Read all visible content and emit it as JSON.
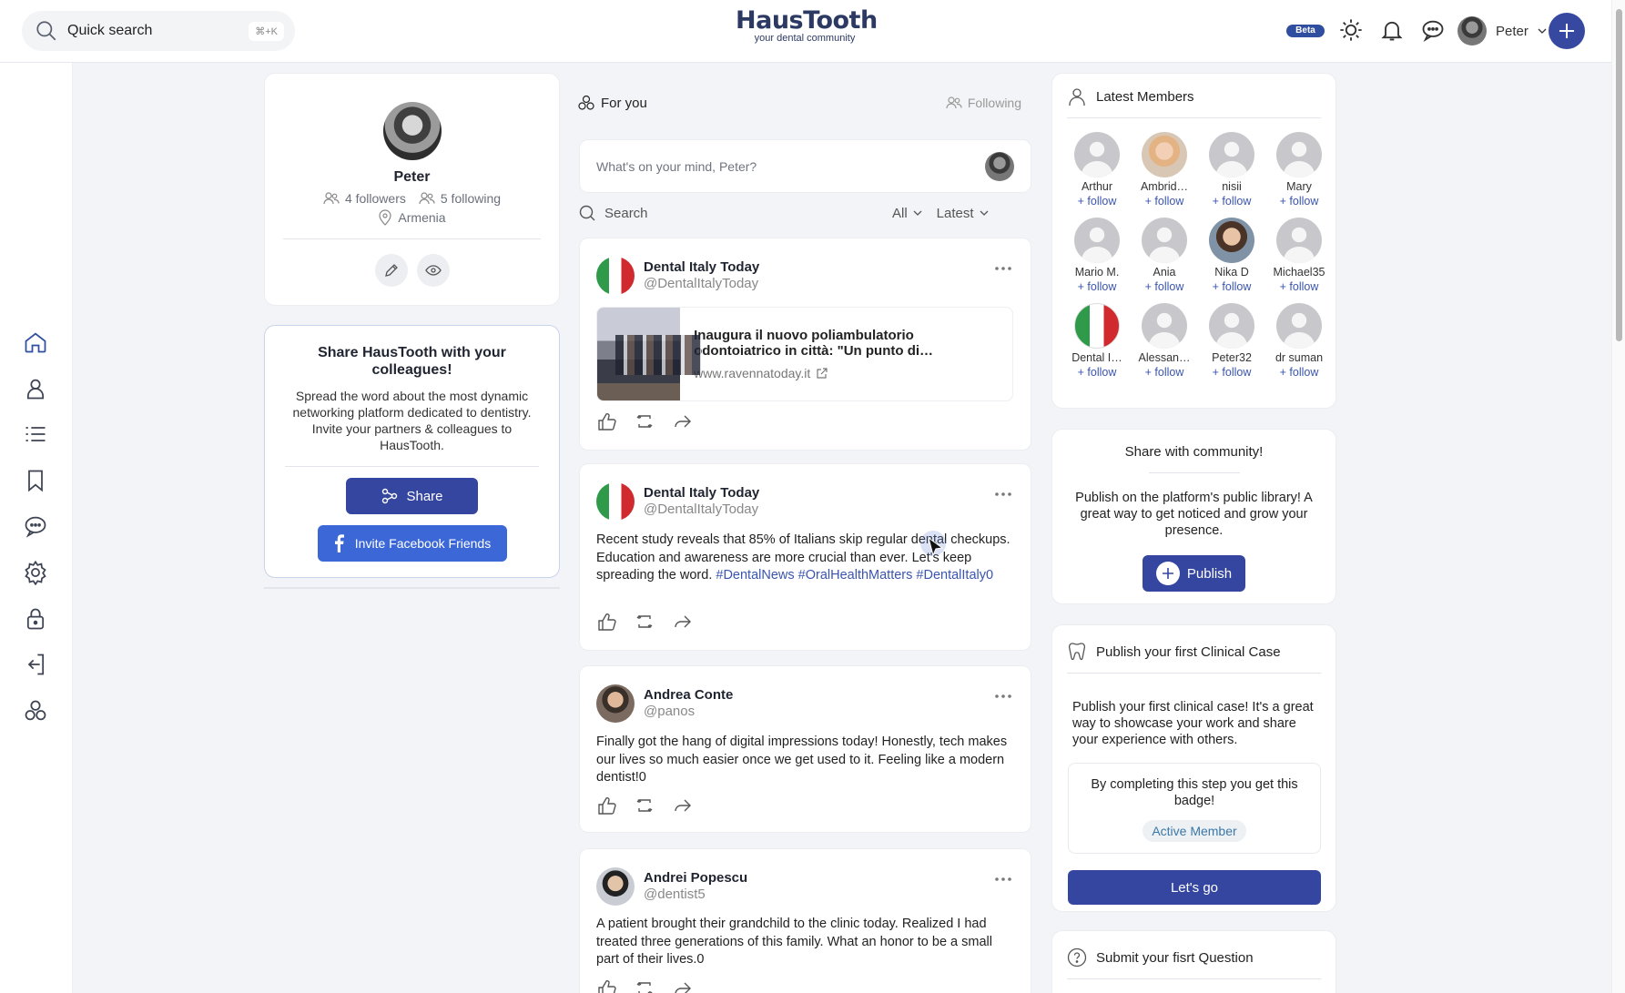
{
  "header": {
    "search_placeholder": "Quick search",
    "search_shortcut": "⌘+K",
    "brand_name": "HausTooth",
    "brand_tagline": "your dental community",
    "beta_label": "Beta",
    "user_name": "Peter"
  },
  "colors": {
    "primary": "#3546a0",
    "facebook": "#3b67d7",
    "link": "#3a55b0",
    "background": "#f3f4f7"
  },
  "sidebar": {
    "items": [
      {
        "name": "home",
        "icon": "home-icon"
      },
      {
        "name": "profile",
        "icon": "user-icon"
      },
      {
        "name": "list",
        "icon": "list-icon"
      },
      {
        "name": "bookmarks",
        "icon": "bookmark-icon"
      },
      {
        "name": "messages",
        "icon": "chat-icon"
      },
      {
        "name": "settings",
        "icon": "gear-icon"
      },
      {
        "name": "privacy",
        "icon": "lock-icon"
      },
      {
        "name": "logout",
        "icon": "logout-icon"
      },
      {
        "name": "community",
        "icon": "community-icon"
      }
    ]
  },
  "profile": {
    "name": "Peter",
    "followers": "4 followers",
    "following": "5 following",
    "location": "Armenia"
  },
  "share_card": {
    "title": "Share HausTooth with your colleagues!",
    "description": "Spread the word about the most dynamic networking platform dedicated to dentistry. Invite your partners & colleagues to HausTooth.",
    "share_label": "Share",
    "facebook_label": "Invite Facebook Friends"
  },
  "feed": {
    "tab_for_you": "For you",
    "tab_following": "Following",
    "composer_placeholder": "What's on your mind, Peter?",
    "search_placeholder": "Search",
    "filter_all": "All",
    "filter_latest": "Latest",
    "posts": [
      {
        "author": "Dental Italy Today",
        "handle": "@DentalItalyToday",
        "link_title": "Inaugura il nuovo poliambulatorio odontoiatrico in città: \"Un punto di…",
        "link_url": "www.ravennatoday.it"
      },
      {
        "author": "Dental Italy Today",
        "handle": "@DentalItalyToday",
        "text": "Recent study reveals that 85% of Italians skip regular dental checkups. Education and awareness are more crucial than ever. Let's keep spreading the word.",
        "hashtags": [
          "#DentalNews",
          "#OralHealthMatters",
          "#DentalItaly0"
        ]
      },
      {
        "author": "Andrea Conte",
        "handle": "@panos",
        "text": "Finally got the hang of digital impressions today! Honestly, tech makes our lives so much easier once we get used to it. Feeling like a modern dentist!0"
      },
      {
        "author": "Andrei Popescu",
        "handle": "@dentist5",
        "text": "A patient brought their grandchild to the clinic today. Realized I had treated three generations of this family. What an honor to be a small part of their lives.0"
      }
    ]
  },
  "latest_members": {
    "title": "Latest Members",
    "follow_label": "+ follow",
    "members": [
      {
        "name": "Arthur"
      },
      {
        "name": "Ambrid…"
      },
      {
        "name": "nisii"
      },
      {
        "name": "Mary"
      },
      {
        "name": "Mario M."
      },
      {
        "name": "Ania"
      },
      {
        "name": "Nika D"
      },
      {
        "name": "Michael35"
      },
      {
        "name": "Dental I…"
      },
      {
        "name": "Alessan…"
      },
      {
        "name": "Peter32"
      },
      {
        "name": "dr suman"
      }
    ]
  },
  "community": {
    "title": "Share with community!",
    "description": "Publish on the platform's public library! A great way to get noticed and grow your presence.",
    "publish_label": "Publish"
  },
  "clinical": {
    "title": "Publish your first Clinical Case",
    "description": "Publish your first clinical case! It's a great way to showcase your work and share your experience with others.",
    "badge_text": "By completing this step you get this badge!",
    "badge_label": "Active Member",
    "button_label": "Let's go"
  },
  "question": {
    "title": "Submit your fisrt Question"
  }
}
